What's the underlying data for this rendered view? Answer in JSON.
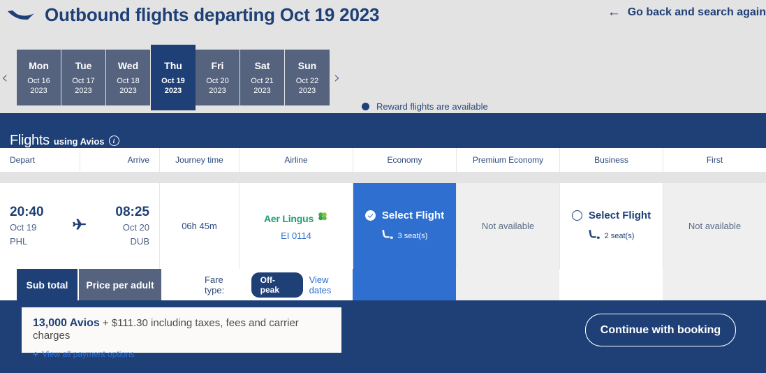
{
  "header": {
    "title": "Outbound flights departing Oct 19 2023",
    "logo_icon": "plane-swoosh-icon",
    "back_link": "Go back and search again",
    "back_icon": "arrow-left-icon"
  },
  "date_strip": {
    "prev_icon": "chevron-left-icon",
    "next_icon": "chevron-right-icon",
    "legend": {
      "dot_icon": "filled-circle-icon",
      "text": "Reward flights are available",
      "dot_color": "#1e4077"
    },
    "dates": [
      {
        "dow": "Mon",
        "date": "Oct 16",
        "year": "2023",
        "selected": false
      },
      {
        "dow": "Tue",
        "date": "Oct 17",
        "year": "2023",
        "selected": false
      },
      {
        "dow": "Wed",
        "date": "Oct 18",
        "year": "2023",
        "selected": false
      },
      {
        "dow": "Thu",
        "date": "Oct 19",
        "year": "2023",
        "selected": true
      },
      {
        "dow": "Fri",
        "date": "Oct 20",
        "year": "2023",
        "selected": false
      },
      {
        "dow": "Sat",
        "date": "Oct 21",
        "year": "2023",
        "selected": false
      },
      {
        "dow": "Sun",
        "date": "Oct 22",
        "year": "2023",
        "selected": false
      }
    ]
  },
  "panel": {
    "heading_main": "Flights",
    "heading_sub": "using Avios",
    "info_icon": "info-circle-icon",
    "background_color": "#1e4077"
  },
  "table": {
    "columns": [
      "Depart",
      "Arrive",
      "Journey time",
      "Airline",
      "Economy",
      "Premium Economy",
      "Business",
      "First"
    ],
    "flight": {
      "depart_time": "20:40",
      "depart_date": "Oct 19",
      "depart_airport": "PHL",
      "arrive_time": "08:25",
      "arrive_date": "Oct 20",
      "arrive_airport": "DUB",
      "plane_icon": "airplane-icon",
      "journey_time": "06h 45m",
      "airline_name": "Aer Lingus",
      "airline_icon": "shamrock-icon",
      "airline_color": "#1c9f70",
      "flight_number": "EI 0114",
      "cabins": [
        {
          "cabin": "Economy",
          "state": "selected",
          "label": "Select Flight",
          "seats": "3 seat(s)",
          "seat_icon": "airline-seat-icon",
          "radio_icon": "radio-checked-icon",
          "color": "#2e6fd0"
        },
        {
          "cabin": "Premium Economy",
          "state": "unavailable",
          "label": "Not available"
        },
        {
          "cabin": "Business",
          "state": "available",
          "label": "Select Flight",
          "seats": "2 seat(s)",
          "seat_icon": "airline-seat-icon",
          "radio_icon": "radio-unchecked-icon"
        },
        {
          "cabin": "First",
          "state": "unavailable",
          "label": "Not available"
        }
      ]
    }
  },
  "subbar": {
    "tab_subtotal": "Sub total",
    "tab_per_adult": "Price per adult",
    "active_tab": "Sub total",
    "fare_type_label": "Fare type:",
    "fare_type_value": "Off-peak",
    "view_dates_link": "View dates"
  },
  "footer": {
    "avios": "13,000 Avios",
    "price_rest": " + $111.30 including taxes, fees and carrier charges",
    "payment_options_link": "View all payment options",
    "plus_icon": "plus-icon",
    "continue_button": "Continue with booking"
  }
}
